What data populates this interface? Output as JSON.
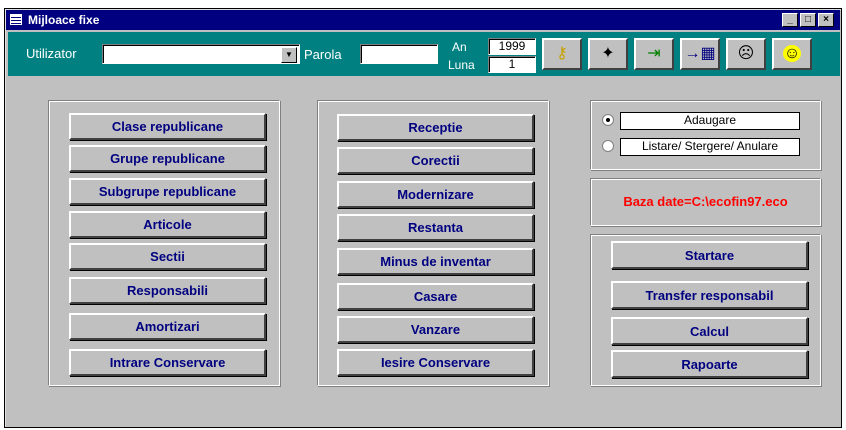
{
  "window": {
    "title": "Mijloace fixe"
  },
  "toolbar": {
    "user_label": "Utilizator",
    "user_value": "",
    "password_label": "Parola",
    "password_value": "",
    "year_label": "An",
    "year_value": "1999",
    "month_label": "Luna",
    "month_value": "1",
    "icons": [
      "key-icon",
      "compass-icon",
      "exit-door-icon",
      "calendar-arrow-icon",
      "sad-face-icon",
      "smiley-icon"
    ]
  },
  "left_buttons": [
    "Clase republicane",
    "Grupe republicane",
    "Subgrupe republicane",
    "Articole",
    "Sectii",
    "Responsabili",
    "Amortizari",
    "Intrare Conservare"
  ],
  "middle_buttons": [
    "Receptie",
    "Corectii",
    "Modernizare",
    "Restanta",
    "Minus de inventar",
    "Casare",
    "Vanzare",
    "Iesire Conservare"
  ],
  "options": [
    {
      "label": "Adaugare",
      "selected": true
    },
    {
      "label": "Listare/ Stergere/ Anulare",
      "selected": false
    }
  ],
  "database_label": "Baza date=C:\\ecofin97.eco",
  "database_color": "#ff0000",
  "right_buttons": [
    "Startare",
    "Transfer responsabil",
    "Calcul",
    "Rapoarte"
  ],
  "colors": {
    "title_bar": "#000080",
    "toolbar": "#008080",
    "button_text": "#000080",
    "face": "#c0c0c0"
  }
}
